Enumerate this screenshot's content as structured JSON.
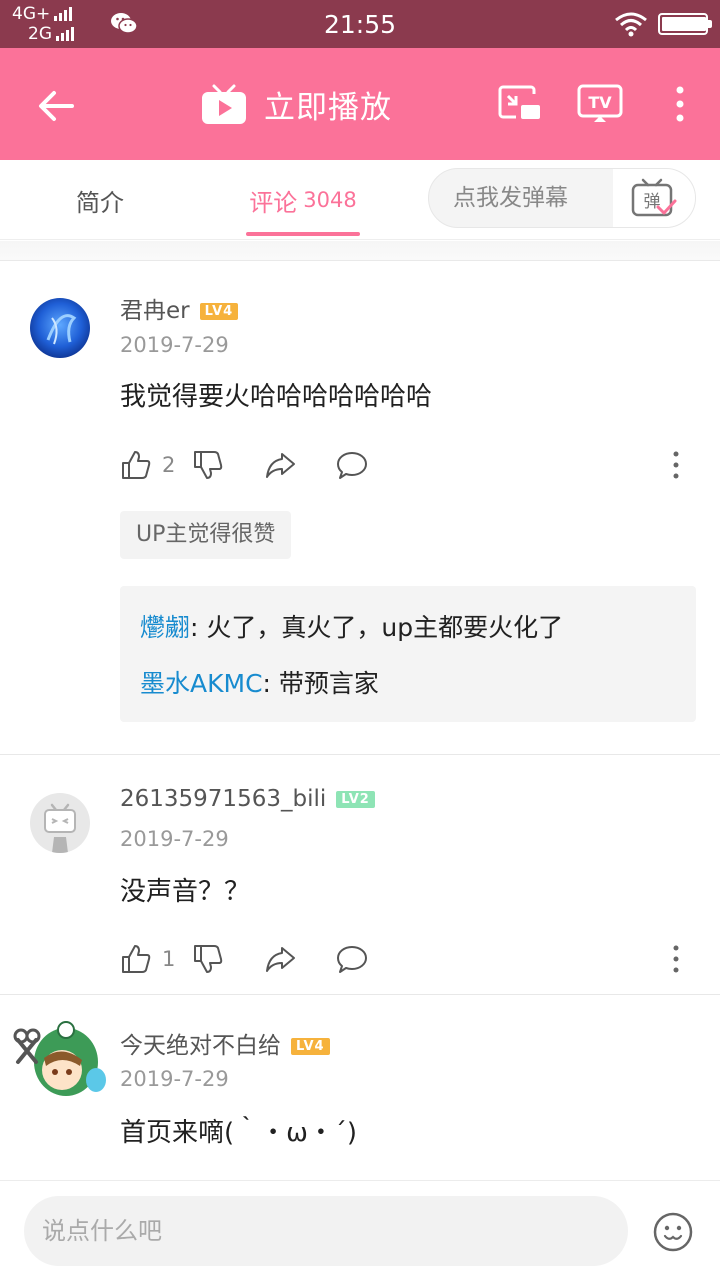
{
  "status_bar": {
    "network_top": "4G+",
    "network_bottom": "2G",
    "time": "21:55",
    "battery_level": 0.95
  },
  "top_bar": {
    "play_now_label": "立即播放",
    "icons": [
      "back-arrow-icon",
      "tv-play-icon",
      "cast-icon",
      "tv-icon",
      "more-vertical-icon"
    ]
  },
  "tabs": {
    "intro": "简介",
    "comments": "评论",
    "comments_count": "3048",
    "danmaku_placeholder": "点我发弹幕",
    "danmaku_icon_text": "弹"
  },
  "comments": [
    {
      "user": "君冉er",
      "level": "LV4",
      "level_color": "#f6b23c",
      "date": "2019-7-29",
      "text": "我觉得要火哈哈哈哈哈哈哈",
      "likes": "2",
      "up_tag": "UP主觉得很赞",
      "replies": [
        {
          "user": "爩翽",
          "text": ": 火了，真火了，up主都要火化了"
        },
        {
          "user": "墨水AKMC",
          "text": ": 带预言家"
        }
      ]
    },
    {
      "user": "26135971563_bili",
      "level": "LV2",
      "level_color": "#8ee4b5",
      "date": "2019-7-29",
      "text": "没声音？？",
      "likes": "1"
    },
    {
      "user": "今天绝对不白给",
      "level": "LV4",
      "level_color": "#f6b23c",
      "date": "2019-7-29",
      "text": "首页来嘀(｀・ω・´)"
    }
  ],
  "bottom": {
    "input_placeholder": "说点什么吧"
  },
  "colors": {
    "status_bar": "#8b3a4e",
    "brand_pink": "#fb7299",
    "reply_user": "#178bcf"
  }
}
